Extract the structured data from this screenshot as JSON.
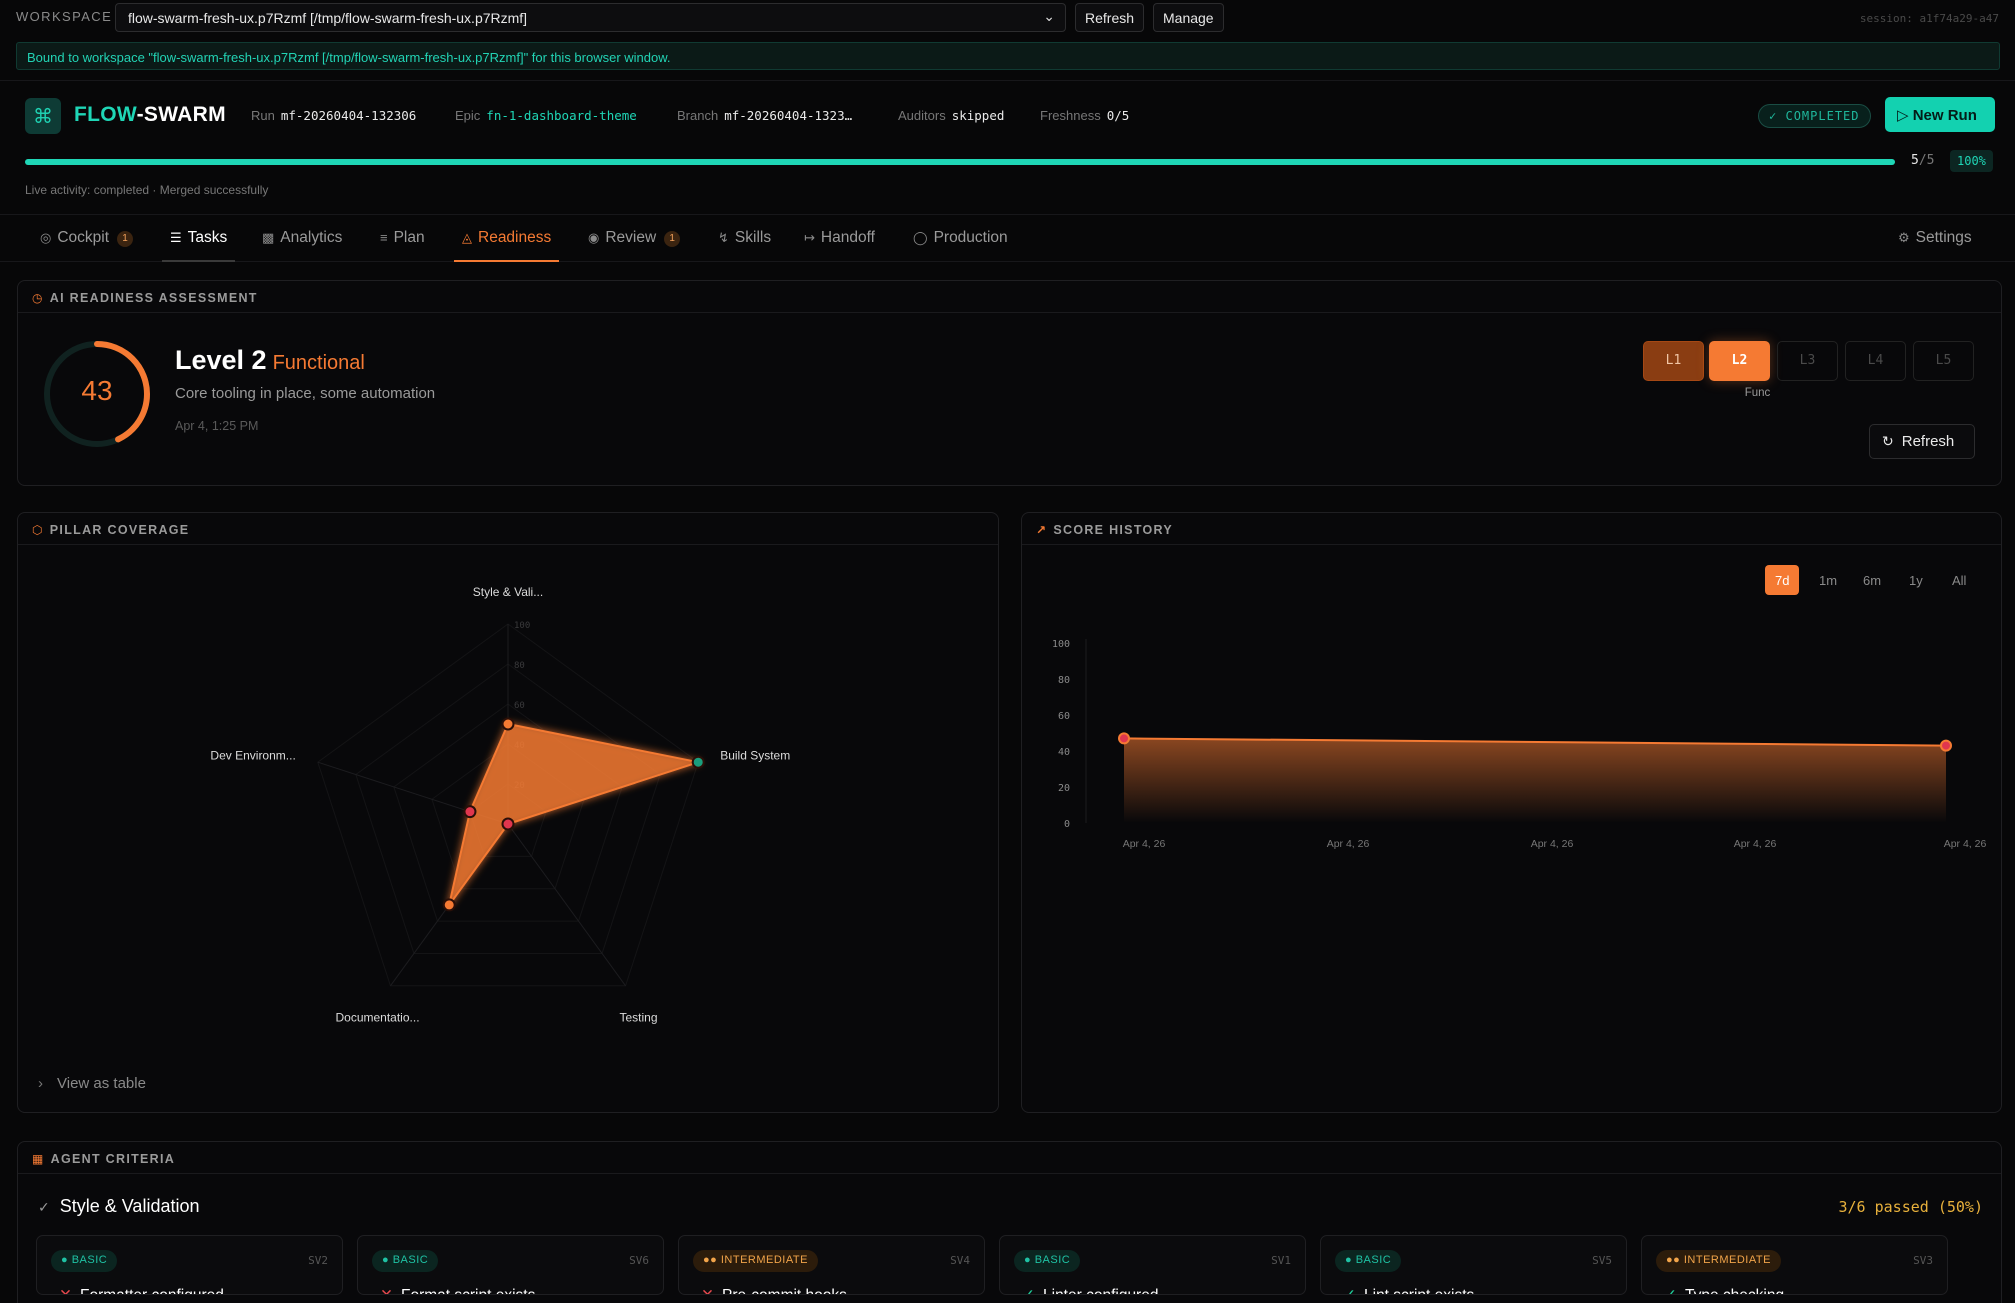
{
  "workspace": {
    "label": "WORKSPACE",
    "selected": "flow-swarm-fresh-ux.p7Rzmf [/tmp/flow-swarm-fresh-ux.p7Rzmf]",
    "refresh_label": "Refresh",
    "manage_label": "Manage",
    "session": "session: a1f74a29-a47",
    "banner": "Bound to workspace \"flow-swarm-fresh-ux.p7Rzmf [/tmp/flow-swarm-fresh-ux.p7Rzmf]\" for this browser window."
  },
  "header": {
    "brand_a": "FLOW",
    "brand_b": "-SWARM",
    "run_label": "Run",
    "run_value": "mf-20260404-132306",
    "epic_label": "Epic",
    "epic_value": "fn-1-dashboard-theme",
    "branch_label": "Branch",
    "branch_value": "mf-20260404-1323…",
    "auditors_label": "Auditors",
    "auditors_value": "skipped",
    "freshness_label": "Freshness",
    "freshness_value": "0/5",
    "status": "COMPLETED",
    "new_run_label": "New Run",
    "progress_done": "5",
    "progress_total": "/5",
    "progress_percent": "100%",
    "progress_fraction": 1.0,
    "live_activity": "Live activity: completed · Merged successfully"
  },
  "tabs": [
    {
      "label": "Cockpit",
      "icon": "target-icon",
      "badge": "1"
    },
    {
      "label": "Tasks",
      "icon": "list-icon"
    },
    {
      "label": "Analytics",
      "icon": "bar-chart-icon"
    },
    {
      "label": "Plan",
      "icon": "plan-icon"
    },
    {
      "label": "Readiness",
      "icon": "gauge-icon"
    },
    {
      "label": "Review",
      "icon": "eye-icon",
      "badge": "1"
    },
    {
      "label": "Skills",
      "icon": "bolt-icon"
    },
    {
      "label": "Handoff",
      "icon": "handoff-icon"
    },
    {
      "label": "Production",
      "icon": "shield-icon"
    },
    {
      "label": "Settings",
      "icon": "gear-icon"
    }
  ],
  "readiness": {
    "title": "AI READINESS ASSESSMENT",
    "score": "43",
    "score_fraction": 0.43,
    "level": "Level 2",
    "level_name": "Functional",
    "description": "Core tooling in place, some automation",
    "date": "Apr 4, 1:25 PM",
    "levels": [
      "L1",
      "L2",
      "L3",
      "L4",
      "L5"
    ],
    "current_level_caption": "Func",
    "refresh_label": "Refresh"
  },
  "pillar": {
    "title": "PILLAR COVERAGE",
    "view_table_label": "View as table"
  },
  "history": {
    "title": "SCORE HISTORY",
    "ranges": [
      "7d",
      "1m",
      "6m",
      "1y",
      "All"
    ],
    "active_range": "7d"
  },
  "chart_data": [
    {
      "type": "radar",
      "axes": [
        "Style & Vali...",
        "Build System",
        "Testing",
        "Documentatio...",
        "Dev Environm..."
      ],
      "values": [
        50,
        100,
        0,
        50,
        20
      ],
      "ticks": [
        "100",
        "80",
        "60",
        "40",
        "20"
      ],
      "range": [
        0,
        100
      ]
    },
    {
      "type": "area",
      "x": [
        "Apr 4, 26",
        "Apr 4, 26",
        "Apr 4, 26",
        "Apr 4, 26",
        "Apr 4, 26"
      ],
      "points": [
        47,
        43
      ],
      "y_ticks": [
        "100",
        "80",
        "60",
        "40",
        "20",
        "0"
      ],
      "ylim": [
        0,
        100
      ]
    }
  ],
  "criteria": {
    "title": "AGENT CRITERIA",
    "group": "Style & Validation",
    "group_stat": "3/6 passed (50%)",
    "items": [
      {
        "tier": "BASIC",
        "id": "SV2",
        "name": "Formatter configured",
        "pass": false
      },
      {
        "tier": "BASIC",
        "id": "SV6",
        "name": "Format script exists",
        "pass": false
      },
      {
        "tier": "INTERMEDIATE",
        "id": "SV4",
        "name": "Pre-commit hooks",
        "pass": false
      },
      {
        "tier": "BASIC",
        "id": "SV1",
        "name": "Linter configured",
        "pass": true
      },
      {
        "tier": "BASIC",
        "id": "SV5",
        "name": "Lint script exists",
        "pass": true
      },
      {
        "tier": "INTERMEDIATE",
        "id": "SV3",
        "name": "Type checking",
        "pass": true
      }
    ]
  },
  "colors": {
    "accent": "#f57a33",
    "teal": "#1fd6b6",
    "fail": "#e5484d",
    "pass": "#20c997"
  }
}
